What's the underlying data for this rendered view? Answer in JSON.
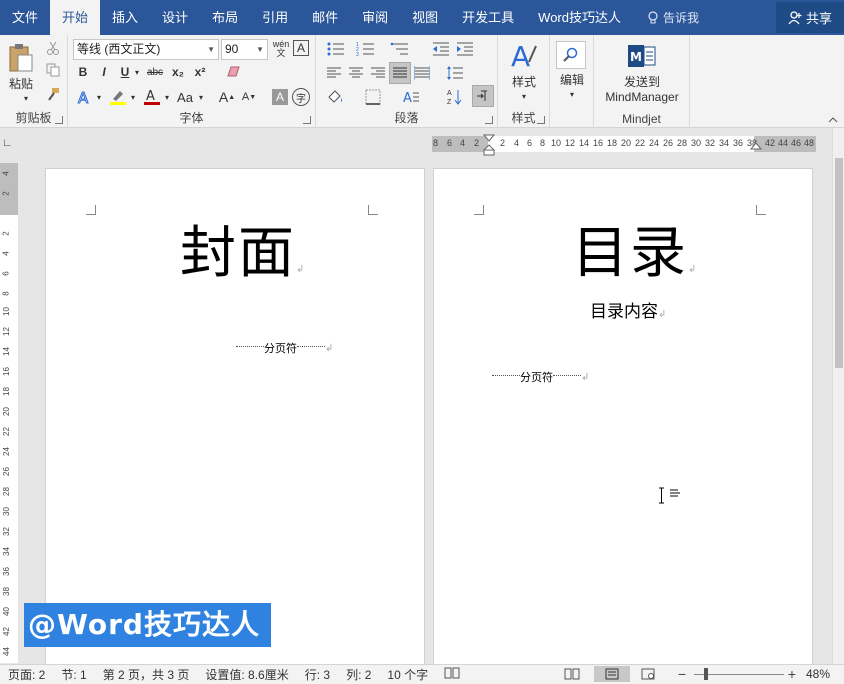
{
  "tabs": [
    "文件",
    "开始",
    "插入",
    "设计",
    "布局",
    "引用",
    "邮件",
    "审阅",
    "视图",
    "开发工具",
    "Word技巧达人"
  ],
  "active_tab": "开始",
  "tell_me": "告诉我",
  "share": "共享",
  "ribbon": {
    "clipboard": {
      "paste": "粘贴",
      "label": "剪贴板"
    },
    "font": {
      "font_name": "等线 (西文正文)",
      "font_size": "90",
      "label": "字体",
      "wen": "wén",
      "wen2": "文",
      "A": "A",
      "bold": "B",
      "italic": "I",
      "underline": "U",
      "strike": "abc",
      "sub": "x₂",
      "sup": "x²",
      "aa": "Aa",
      "grow": "A",
      "shrink": "A",
      "circle": "字"
    },
    "paragraph": {
      "label": "段落"
    },
    "styles": {
      "styles": "样式",
      "label": "样式"
    },
    "editing": {
      "edit": "编辑"
    },
    "mindjet": {
      "send_to": "发送到",
      "mind": "MindManager",
      "label": "Mindjet"
    }
  },
  "ruler": {
    "h_left": [
      "8",
      "6",
      "4",
      "2"
    ],
    "h_main": [
      "2",
      "4",
      "6",
      "8",
      "10",
      "12",
      "14",
      "16",
      "18",
      "20",
      "22",
      "24",
      "26",
      "28",
      "30",
      "32",
      "34",
      "36",
      "38"
    ],
    "h_right": [
      "42",
      "44",
      "46",
      "48"
    ],
    "v": [
      "4",
      "2",
      "2",
      "4",
      "6",
      "8",
      "10",
      "12",
      "14",
      "16",
      "18",
      "20",
      "22",
      "24",
      "26",
      "28",
      "30",
      "32",
      "34",
      "36",
      "38",
      "40",
      "42",
      "44"
    ]
  },
  "pages": [
    {
      "title": "封面",
      "break": "分页符"
    },
    {
      "title": "目录",
      "content": "目录内容",
      "break": "分页符"
    }
  ],
  "para_mark": "↲",
  "watermark": "@Word技巧达人",
  "status": {
    "page": "页面: 2",
    "section": "节: 1",
    "page_of": "第 2 页，共 3 页",
    "setting": "设置值: 8.6厘米",
    "line": "行: 3",
    "col": "列: 2",
    "words": "10 个字",
    "zoom": "48%",
    "minus": "−",
    "plus": "+"
  },
  "colors": {
    "brand": "#2b579a",
    "watermark_bg": "#2f82e0"
  }
}
